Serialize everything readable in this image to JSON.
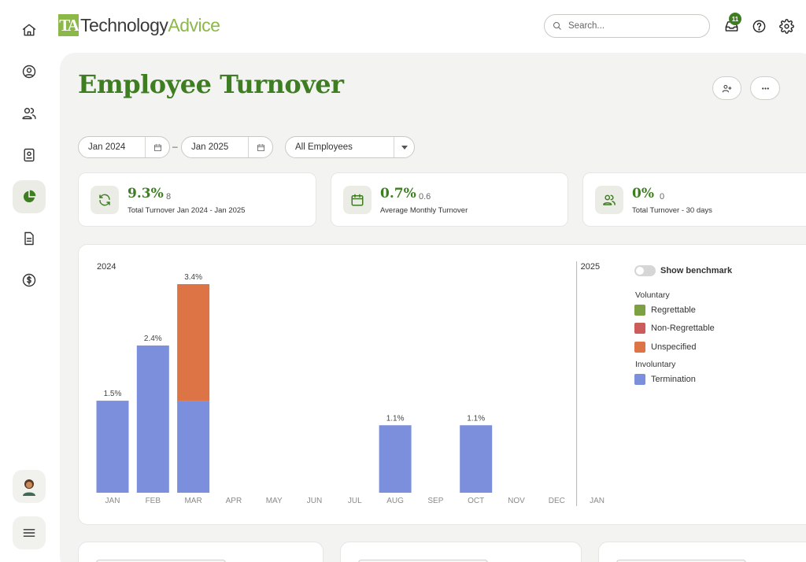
{
  "brand": {
    "mark": "TA",
    "name_a": "Technology",
    "name_b": "Advice",
    "green": "#3e7d22",
    "light_green": "#8cb84a"
  },
  "search": {
    "placeholder": "Search..."
  },
  "notifications": {
    "count": "11"
  },
  "rail": {
    "items": [
      "home-icon",
      "user-circle-icon",
      "users-icon",
      "id-badge-icon",
      "pie-chart-icon",
      "document-icon",
      "dollar-icon"
    ],
    "active": "pie-chart-icon",
    "bottom": [
      "avatar",
      "menu-icon"
    ]
  },
  "page": {
    "title": "Employee Turnover"
  },
  "filters": {
    "start": "Jan 2024",
    "end": "Jan 2025",
    "separator": "–",
    "group": "All Employees"
  },
  "stats": [
    {
      "icon": "refresh-icon",
      "value": "9.3%",
      "count": "8",
      "label": "Total Turnover Jan 2024 - Jan 2025"
    },
    {
      "icon": "calendar-icon",
      "value": "0.7%",
      "count": "0.6",
      "label": "Average Monthly Turnover"
    },
    {
      "icon": "users-icon",
      "value": "0%",
      "count": "0",
      "label": "Total Turnover - 30 days"
    }
  ],
  "legend": {
    "benchmark_label": "Show benchmark",
    "benchmark_on": false,
    "voluntary_label": "Voluntary",
    "involuntary_label": "Involuntary",
    "items": [
      {
        "label": "Regrettable",
        "color": "#7da043"
      },
      {
        "label": "Non-Regrettable",
        "color": "#cc5b5b"
      },
      {
        "label": "Unspecified",
        "color": "#dc7445"
      },
      {
        "label": "Termination",
        "color": "#7b8fdd"
      }
    ]
  },
  "chart_data": {
    "type": "bar",
    "stacked": true,
    "year_labels": [
      "2024",
      "2025"
    ],
    "categories": [
      "JAN",
      "FEB",
      "MAR",
      "APR",
      "MAY",
      "JUN",
      "JUL",
      "AUG",
      "SEP",
      "OCT",
      "NOV",
      "DEC",
      "JAN"
    ],
    "totals_labels": [
      "1.5%",
      "2.4%",
      "3.4%",
      "",
      "",
      "",
      "",
      "1.1%",
      "",
      "1.1%",
      "",
      "",
      ""
    ],
    "series": [
      {
        "name": "Termination",
        "color": "#7b8fdd",
        "values": [
          1.5,
          2.4,
          1.5,
          0,
          0,
          0,
          0,
          1.1,
          0,
          1.1,
          0,
          0,
          0
        ]
      },
      {
        "name": "Unspecified",
        "color": "#dc7445",
        "values": [
          0,
          0,
          1.9,
          0,
          0,
          0,
          0,
          0,
          0,
          0,
          0,
          0,
          0
        ]
      }
    ],
    "ylim": [
      0,
      3.4
    ],
    "grid": false
  }
}
